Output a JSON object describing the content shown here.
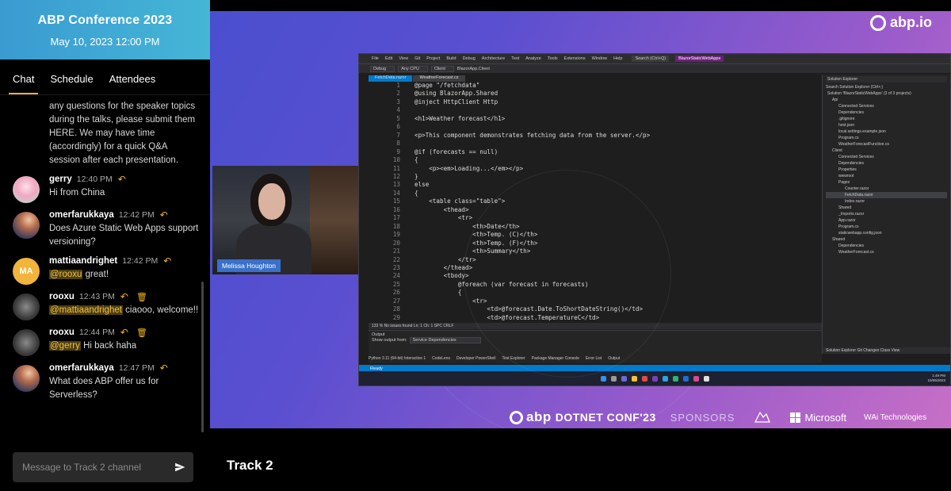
{
  "event": {
    "title": "ABP Conference 2023",
    "date": "May 10, 2023 12:00 PM"
  },
  "tabs": [
    {
      "label": "Chat",
      "active": true
    },
    {
      "label": "Schedule",
      "active": false
    },
    {
      "label": "Attendees",
      "active": false
    }
  ],
  "chat": {
    "system_message": "any questions for the speaker topics during the talks, please submit them HERE. We may have time (accordingly) for a quick Q&A session after each presentation.",
    "messages": [
      {
        "user": "gerry",
        "time": "12:40 PM",
        "text": "Hi from China"
      },
      {
        "user": "omerfarukkaya",
        "time": "12:42 PM",
        "text": "Does Azure Static Web Apps support versioning?"
      },
      {
        "user": "mattiaandrighet",
        "initials": "MA",
        "time": "12:42 PM",
        "mention": "@rooxu",
        "text": " great!"
      },
      {
        "user": "rooxu",
        "time": "12:43 PM",
        "mention": "@mattiaandrighet",
        "text": " ciaooo, welcome!!"
      },
      {
        "user": "rooxu",
        "time": "12:44 PM",
        "mention": "@gerry",
        "text": " Hi back haha"
      },
      {
        "user": "omerfarukkaya",
        "time": "12:47 PM",
        "text": "What does ABP offer us for Serverless?"
      }
    ],
    "input_placeholder": "Message to Track 2 channel"
  },
  "stage": {
    "brand": "abp.io",
    "speaker_name": "Melissa Houghton",
    "conf_brand": "abp",
    "conf_name": "DOTNET CONF'23",
    "sponsors_label": "SPONSORS",
    "sponsor_microsoft": "Microsoft",
    "sponsor_wai": "WAi Technologies"
  },
  "ide": {
    "menu": [
      "File",
      "Edit",
      "View",
      "Git",
      "Project",
      "Build",
      "Debug",
      "Architecture",
      "Test",
      "Analyze",
      "Tools",
      "Extensions",
      "Window",
      "Help"
    ],
    "search": "Search (Ctrl+Q)",
    "solution_name": "BlazorStaticWebApps",
    "toolbar": [
      "Debug",
      "Any CPU",
      "Client",
      "BlazorApp.Client"
    ],
    "tabs": [
      "FetchData.razor",
      "WeatherForecast.cs"
    ],
    "code": [
      {
        "n": "1",
        "t": "@page \"/fetchdata\""
      },
      {
        "n": "2",
        "t": "@using BlazorApp.Shared"
      },
      {
        "n": "3",
        "t": "@inject HttpClient Http"
      },
      {
        "n": "4",
        "t": ""
      },
      {
        "n": "5",
        "t": "<h1>Weather forecast</h1>"
      },
      {
        "n": "6",
        "t": ""
      },
      {
        "n": "7",
        "t": "<p>This component demonstrates fetching data from the server.</p>"
      },
      {
        "n": "8",
        "t": ""
      },
      {
        "n": "9",
        "t": "@if (forecasts == null)"
      },
      {
        "n": "10",
        "t": "{"
      },
      {
        "n": "11",
        "t": "    <p><em>Loading...</em></p>"
      },
      {
        "n": "12",
        "t": "}"
      },
      {
        "n": "13",
        "t": "else"
      },
      {
        "n": "14",
        "t": "{"
      },
      {
        "n": "15",
        "t": "    <table class=\"table\">"
      },
      {
        "n": "16",
        "t": "        <thead>"
      },
      {
        "n": "17",
        "t": "            <tr>"
      },
      {
        "n": "18",
        "t": "                <th>Date</th>"
      },
      {
        "n": "19",
        "t": "                <th>Temp. (C)</th>"
      },
      {
        "n": "20",
        "t": "                <th>Temp. (F)</th>"
      },
      {
        "n": "21",
        "t": "                <th>Summary</th>"
      },
      {
        "n": "22",
        "t": "            </tr>"
      },
      {
        "n": "23",
        "t": "        </thead>"
      },
      {
        "n": "24",
        "t": "        <tbody>"
      },
      {
        "n": "25",
        "t": "            @foreach (var forecast in forecasts)"
      },
      {
        "n": "26",
        "t": "            {"
      },
      {
        "n": "27",
        "t": "                <tr>"
      },
      {
        "n": "28",
        "t": "                    <td>@forecast.Date.ToShortDateString()</td>"
      },
      {
        "n": "29",
        "t": "                    <td>@forecast.TemperatureC</td>"
      }
    ],
    "solution_title": "Solution Explorer",
    "solution_search": "Search Solution Explorer (Ctrl+;)",
    "solution_items": [
      "Solution 'BlazorStaticWebApps' (3 of 3 projects)",
      "Api",
      "Connected Services",
      "Dependencies",
      ".gitignore",
      "host.json",
      "local.settings.example.json",
      "Program.cs",
      "WeatherForecastFunction.cs",
      "Client",
      "Connected Services",
      "Dependencies",
      "Properties",
      "wwwroot",
      "Pages",
      "Counter.razor",
      "FetchData.razor",
      "Index.razor",
      "Shared",
      "_Imports.razor",
      "App.razor",
      "Program.cs",
      "staticwebapp.config.json",
      "Shared",
      "Dependencies",
      "WeatherForecast.cs"
    ],
    "solution_footer": "Solution Explorer   Git Changes   Class View",
    "code_status": "133 %     No issues found                                                                  Ln: 1   Ch: 1   SPC   CRLF",
    "output_title": "Output",
    "output_from_label": "Show output from:",
    "output_from_value": "Service Dependencies",
    "output_tabs": [
      "Python 3.11 (64-bit) Interactive 1",
      "CodeLens",
      "Developer PowerShell",
      "Test Explorer",
      "Package Manager Console",
      "Error List",
      "Output"
    ],
    "status": "Ready",
    "clock_time": "1:49 PM",
    "clock_date": "10/05/2023"
  },
  "track": "Track 2",
  "colors": {
    "accent": "#f0b429",
    "header_gradient_start": "#3a9bd1",
    "header_gradient_end": "#45b6d6",
    "stage_start": "#4a4fcf",
    "stage_end": "#c76fc6"
  }
}
